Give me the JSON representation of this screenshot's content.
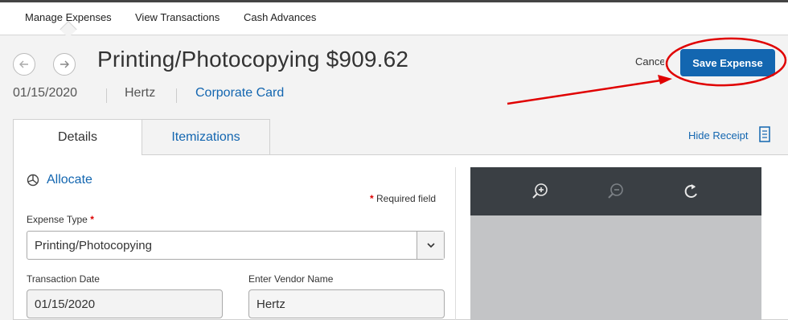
{
  "nav": {
    "items": [
      "Manage Expenses",
      "View Transactions",
      "Cash Advances"
    ]
  },
  "expense": {
    "title": "Printing/Photocopying $909.62",
    "date": "01/15/2020",
    "vendor": "Hertz",
    "payment_type": "Corporate Card"
  },
  "actions": {
    "cancel_label": "Cancel",
    "save_label": "Save Expense"
  },
  "tabs": {
    "details": "Details",
    "itemizations": "Itemizations"
  },
  "receipt": {
    "hide_label": "Hide Receipt"
  },
  "form": {
    "allocate_label": "Allocate",
    "required_marker": "*",
    "required_text": "Required field",
    "expense_type_label": "Expense Type",
    "expense_type_value": "Printing/Photocopying",
    "transaction_date_label": "Transaction Date",
    "transaction_date_value": "01/15/2020",
    "vendor_label": "Enter Vendor Name",
    "vendor_value": "Hertz"
  },
  "colors": {
    "accent": "#1366b0",
    "required": "#dd0000",
    "annotation": "#e00000",
    "viewer_toolbar": "#3a3f44"
  }
}
